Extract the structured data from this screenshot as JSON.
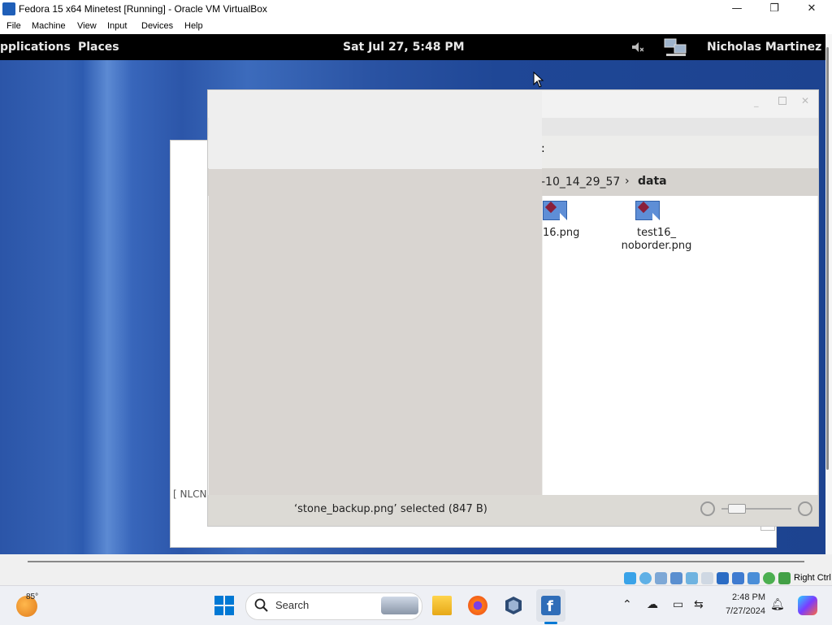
{
  "window": {
    "title": "Fedora 15 x64 Minetest [Running] - Oracle VM VirtualBox",
    "controls": {
      "minimize": "—",
      "maximize": "❐",
      "close": "✕"
    }
  },
  "menubar": {
    "items": [
      "File",
      "Machine",
      "View",
      "Input",
      "Devices",
      "Help"
    ]
  },
  "guest": {
    "panel": {
      "applications": "pplications",
      "places": "Places",
      "clock": "Sat Jul 27,  5:48 PM",
      "user": "Nicholas Martinez"
    },
    "nautilus": {
      "path_prev": "-10_14_29_57",
      "path_sep": "›",
      "path_current": "data",
      "toolbar_fragment": ":",
      "files": [
        {
          "name_line1": "16.png",
          "name_line2": ""
        },
        {
          "name_line1": "test16_",
          "name_line2": "noborder.png"
        }
      ],
      "status": "‘stone_backup.png’ selected (847 B)"
    },
    "back_window_fragment": "[ NLCN"
  },
  "vb_status": {
    "host_key": "Right Ctrl"
  },
  "taskbar": {
    "weather_temp": "85°",
    "search_placeholder": "Search",
    "time": "2:48 PM",
    "date": "7/27/2024"
  },
  "colors": {
    "desktop_blue": "#2b55a8",
    "panel_black": "#000000",
    "status_bar": "#dcdad5",
    "windows_accent": "#0078d4"
  }
}
